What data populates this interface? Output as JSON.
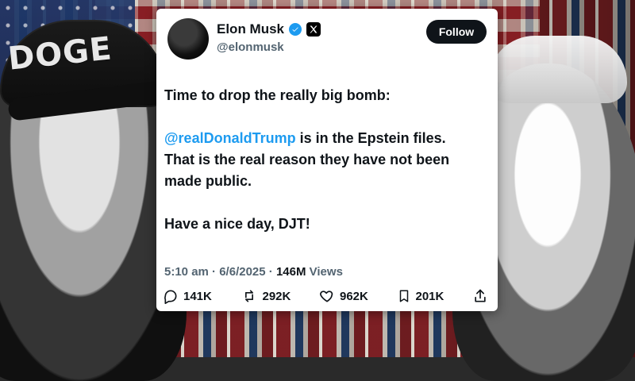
{
  "tweet": {
    "author_name": "Elon Musk",
    "handle": "@elonmusk",
    "follow_label": "Follow",
    "text": {
      "line1": "Time to drop the really big bomb:",
      "mention": "@realDonaldTrump",
      "line2_rest": " is in the Epstein files.",
      "line3": "That is the real reason they have not been",
      "line4": "made public.",
      "line5": "Have a nice day, DJT!"
    },
    "time": "5:10 am",
    "date": "6/6/2025",
    "views_number": "146M",
    "views_label": "Views"
  },
  "actions": {
    "replies": "141K",
    "reposts": "292K",
    "likes": "962K",
    "bookmarks": "201K"
  },
  "background": {
    "hat_text": "DOGE"
  },
  "colors": {
    "accent": "#1d9bf0",
    "text": "#0f1419",
    "muted": "#536471",
    "button_bg": "#0f1419"
  },
  "icons": [
    "verified-badge-icon",
    "x-logo-icon",
    "reply-icon",
    "repost-icon",
    "like-icon",
    "bookmark-icon",
    "share-icon"
  ]
}
